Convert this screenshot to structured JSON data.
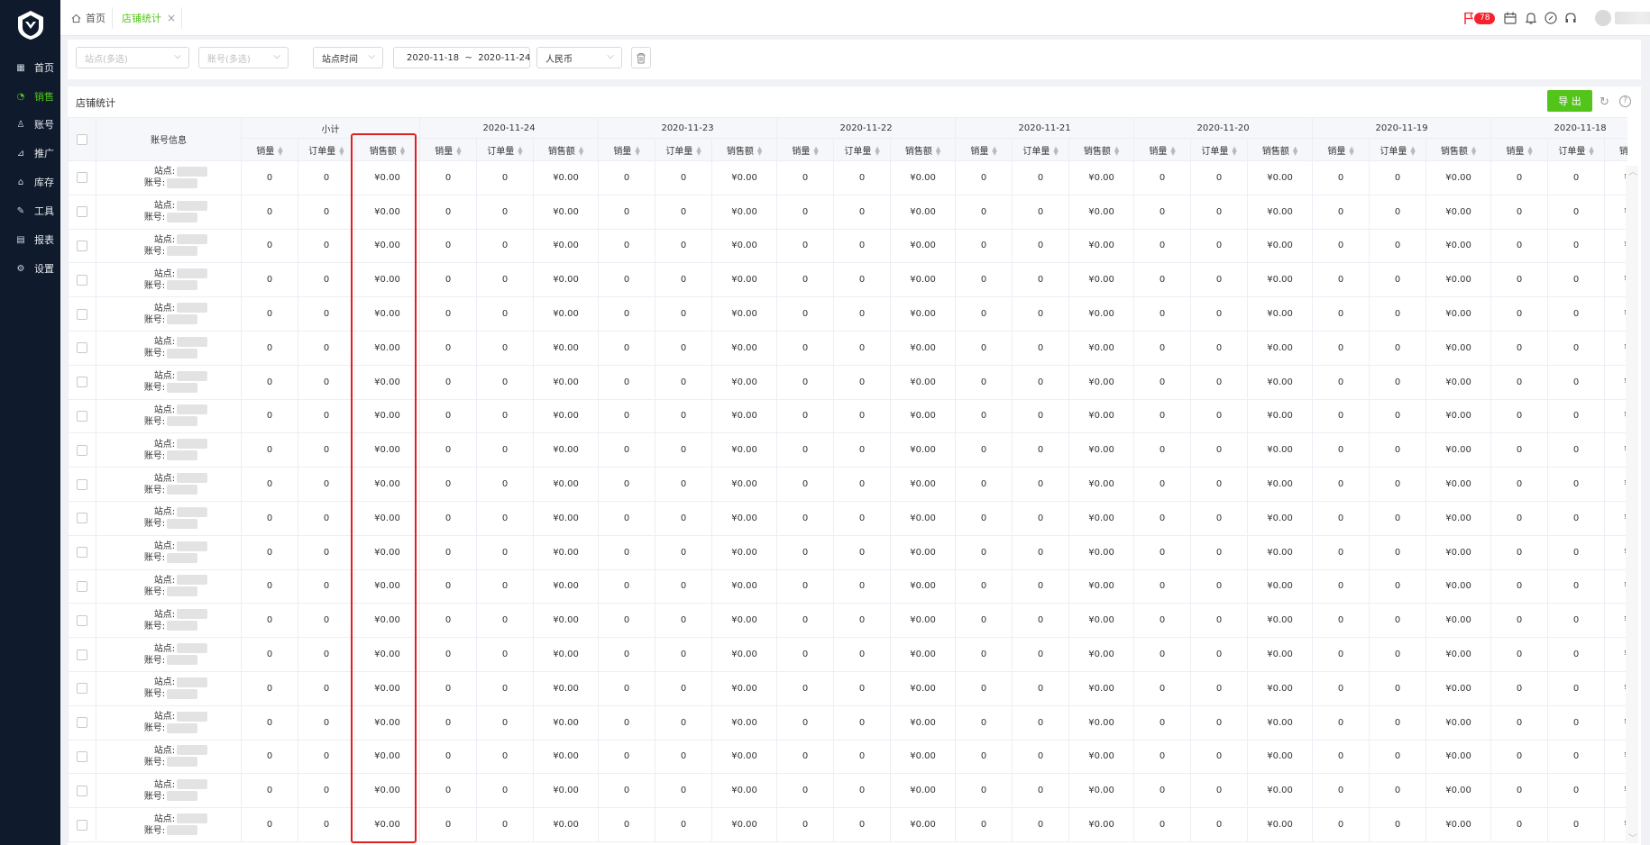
{
  "brand": {
    "logo": "shield-logo"
  },
  "sidebar": {
    "items": [
      {
        "label": "首页",
        "icon": "grid-icon",
        "active": false
      },
      {
        "label": "销售",
        "icon": "pie-chart-icon",
        "active": true
      },
      {
        "label": "账号",
        "icon": "user-icon",
        "active": false
      },
      {
        "label": "推广",
        "icon": "trend-icon",
        "active": false
      },
      {
        "label": "库存",
        "icon": "warehouse-icon",
        "active": false
      },
      {
        "label": "工具",
        "icon": "tool-icon",
        "active": false
      },
      {
        "label": "报表",
        "icon": "table-icon",
        "active": false
      },
      {
        "label": "设置",
        "icon": "gear-icon",
        "active": false
      }
    ]
  },
  "tabs": {
    "home": "首页",
    "stats": "店铺统计",
    "close": "×"
  },
  "header": {
    "notification_count": "78",
    "icons": [
      "flag-icon",
      "calendar-icon",
      "bell-icon",
      "link-icon",
      "headset-icon"
    ]
  },
  "filters": {
    "site_placeholder": "站点(多选)",
    "account_placeholder": "账号(多选)",
    "time_type": "站点时间",
    "date_range": "2020-11-18  ~  2020-11-24",
    "currency": "人民币"
  },
  "panel": {
    "title": "店铺统计",
    "export_label": "导 出"
  },
  "table": {
    "account_header": "账号信息",
    "subtotal_header": "小计",
    "dates": [
      "2020-11-24",
      "2020-11-23",
      "2020-11-22",
      "2020-11-21",
      "2020-11-20",
      "2020-11-19",
      "2020-11-18"
    ],
    "metric_headers": [
      "销量",
      "订单量",
      "销售额"
    ],
    "site_label": "站点:",
    "account_label": "账号:",
    "row_count": 20,
    "row_values": [
      "0",
      "0",
      "¥0.00"
    ]
  },
  "colors": {
    "accent": "#52c41a",
    "sidebar_bg": "#0f1b2c",
    "highlight": "#e02020",
    "badge": "#f5222d"
  }
}
